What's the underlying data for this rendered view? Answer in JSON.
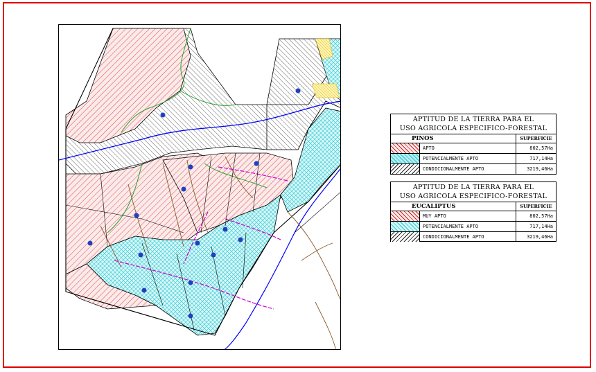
{
  "legends": [
    {
      "title_line1": "APTITUD DE LA TIERRA PARA EL",
      "title_line2": "USO AGRICOLA ESPECIFICO-FORESTAL",
      "species": "PINOS",
      "area_header": "SUPERFICIE",
      "rows": [
        {
          "label": "APTO",
          "area": "802,57Ha",
          "pattern": "red-hatch"
        },
        {
          "label": "POTENCIALMENTE APTO",
          "area": "717,14Ha",
          "pattern": "cyan-cross"
        },
        {
          "label": "CONDICIONALMENTE APTO",
          "area": "3219,46Ha",
          "pattern": "black-hatch"
        }
      ]
    },
    {
      "title_line1": "APTITUD DE LA TIERRA PARA EL",
      "title_line2": "USO AGRICOLA ESPECIFICO-FORESTAL",
      "species": "EUCALIPTUS",
      "area_header": "SUPERFICIE",
      "rows": [
        {
          "label": "MUY APTO",
          "area": "802,57Ha",
          "pattern": "red-hatch"
        },
        {
          "label": "POTENCIALMENTE APTO",
          "area": "717,14Ha",
          "pattern": "cyan-cross"
        },
        {
          "label": "CONDICIONALMENTE APTO",
          "area": "3219,46Ha",
          "pattern": "black-hatch"
        }
      ]
    }
  ],
  "colors": {
    "frame": "#e00000",
    "apto": "#d42020",
    "potencial": "#20c8d0",
    "potencial_fill": "#d8f6f8",
    "condicional": "#000000",
    "river": "#0000ff",
    "contour": "#8b5a2b",
    "road": "#cc00cc",
    "stream": "#2aa02a"
  }
}
